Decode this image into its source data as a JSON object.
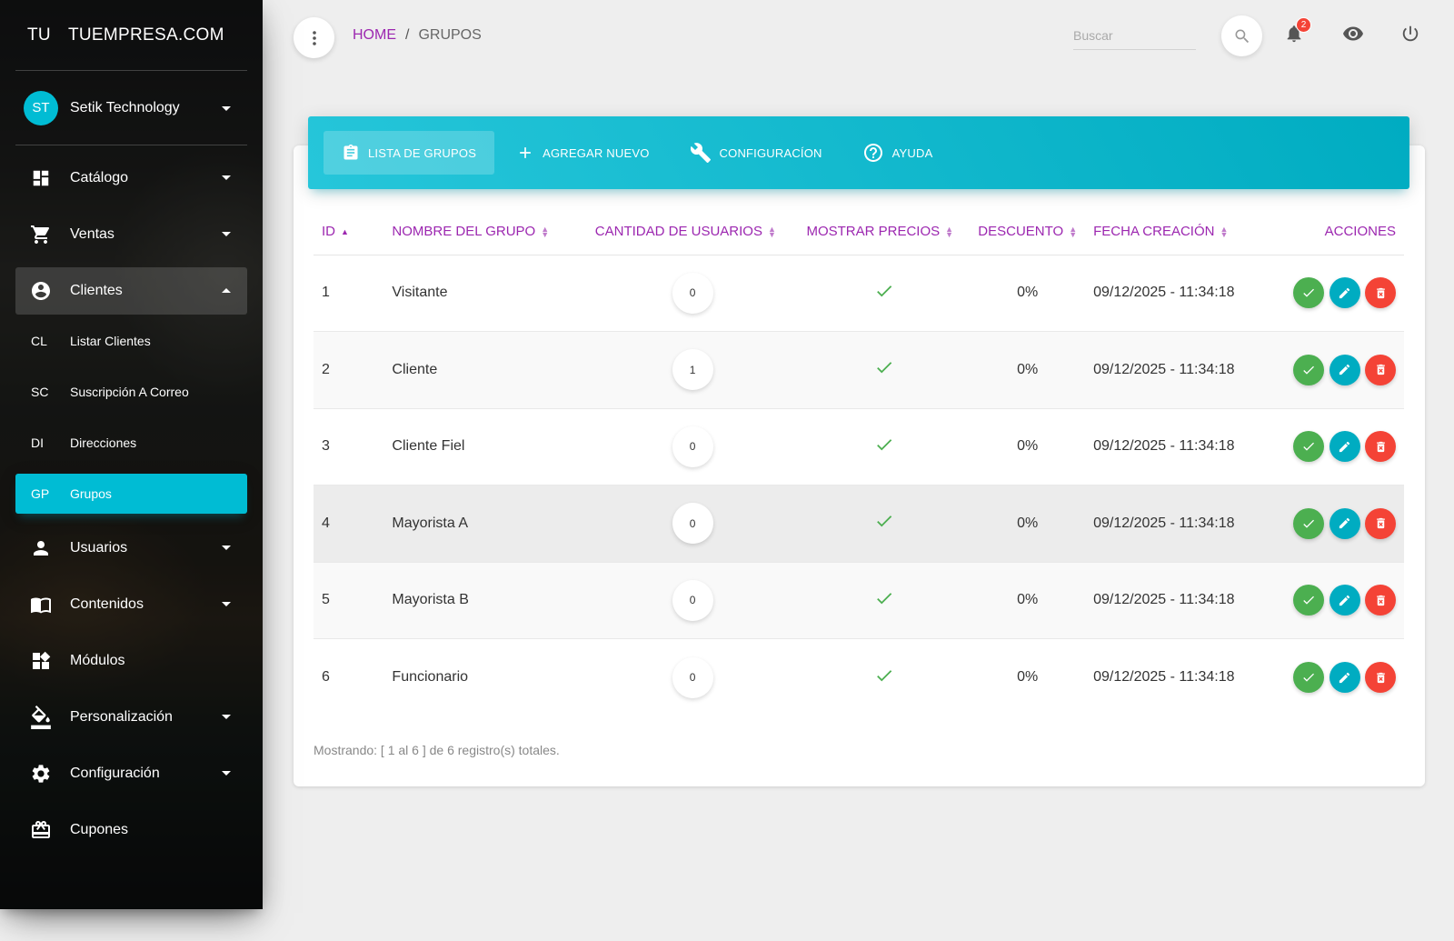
{
  "brand": {
    "mini": "TU",
    "name": "TUEMPRESA.COM"
  },
  "user": {
    "initials": "ST",
    "name": "Setik Technology"
  },
  "nav": {
    "catalogo": "Catálogo",
    "ventas": "Ventas",
    "clientes": "Clientes",
    "sub": [
      {
        "mini": "CL",
        "label": "Listar Clientes"
      },
      {
        "mini": "SC",
        "label": "Suscripción A Correo"
      },
      {
        "mini": "DI",
        "label": "Direcciones"
      },
      {
        "mini": "GP",
        "label": "Grupos"
      }
    ],
    "usuarios": "Usuarios",
    "contenidos": "Contenidos",
    "modulos": "Módulos",
    "personalizacion": "Personalización",
    "configuracion": "Configuración",
    "cupones": "Cupones"
  },
  "breadcrumb": {
    "home": "HOME",
    "sep": "/",
    "current": "GRUPOS"
  },
  "search": {
    "placeholder": "Buscar"
  },
  "notifications": {
    "count": "2"
  },
  "tabs": {
    "list": "LISTA DE GRUPOS",
    "add": "AGREGAR NUEVO",
    "config": "CONFIGURACÍON",
    "help": "AYUDA"
  },
  "table": {
    "headers": {
      "id": "ID",
      "name": "NOMBRE DEL GRUPO",
      "users": "CANTIDAD DE USUARIOS",
      "prices": "MOSTRAR PRECIOS",
      "discount": "DESCUENTO",
      "date": "FECHA CREACIÓN",
      "actions": "ACCIONES"
    },
    "rows": [
      {
        "id": "1",
        "name": "Visitante",
        "users": "0",
        "discount": "0%",
        "date": "09/12/2025 - 11:34:18"
      },
      {
        "id": "2",
        "name": "Cliente",
        "users": "1",
        "discount": "0%",
        "date": "09/12/2025 - 11:34:18"
      },
      {
        "id": "3",
        "name": "Cliente Fiel",
        "users": "0",
        "discount": "0%",
        "date": "09/12/2025 - 11:34:18"
      },
      {
        "id": "4",
        "name": "Mayorista A",
        "users": "0",
        "discount": "0%",
        "date": "09/12/2025 - 11:34:18"
      },
      {
        "id": "5",
        "name": "Mayorista B",
        "users": "0",
        "discount": "0%",
        "date": "09/12/2025 - 11:34:18"
      },
      {
        "id": "6",
        "name": "Funcionario",
        "users": "0",
        "discount": "0%",
        "date": "09/12/2025 - 11:34:18"
      }
    ]
  },
  "footer": {
    "showing": "Mostrando: [ 1 al 6 ] de 6 registro(s) totales."
  },
  "colors": {
    "accent": "#9c27b0",
    "primary": "#00bcd4",
    "success": "#4caf50",
    "danger": "#f44336"
  }
}
